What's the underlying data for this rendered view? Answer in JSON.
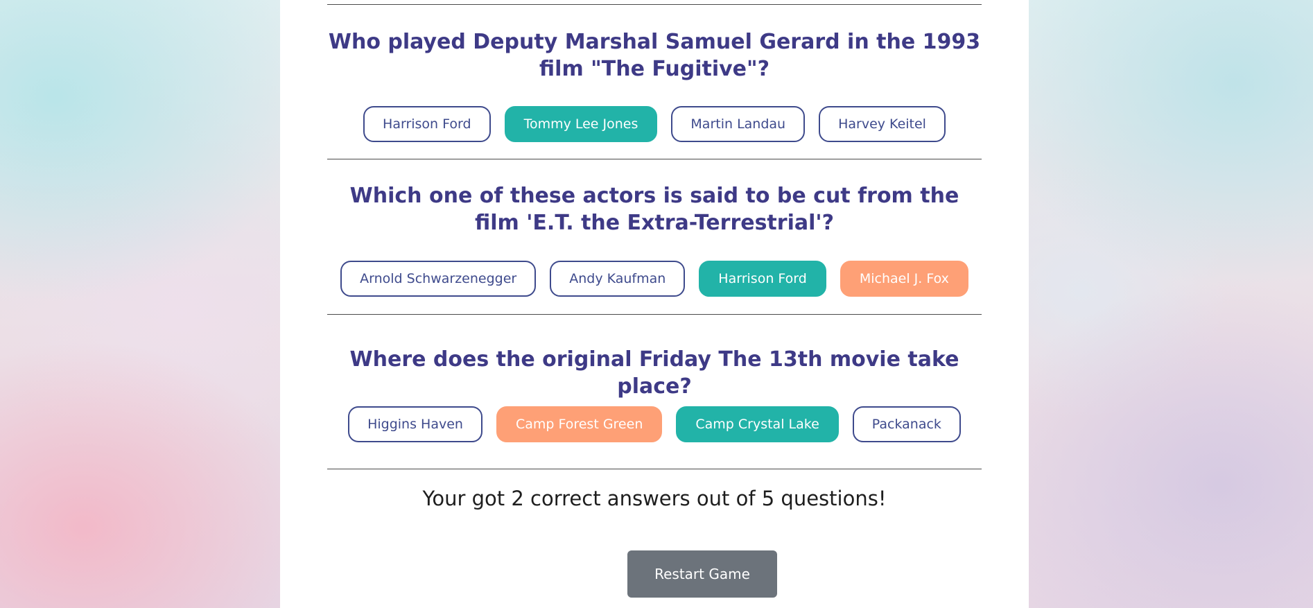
{
  "quiz": {
    "questions": [
      {
        "text": "Who played Deputy Marshal Samuel Gerard in the 1993 film \"The Fugitive\"?",
        "answers": [
          {
            "label": "Harrison Ford",
            "state": "default"
          },
          {
            "label": "Tommy Lee Jones",
            "state": "correct"
          },
          {
            "label": "Martin Landau",
            "state": "default"
          },
          {
            "label": "Harvey Keitel",
            "state": "default"
          }
        ]
      },
      {
        "text": "Which one of these actors is said to be cut from the film 'E.T. the Extra-Terrestrial'?",
        "answers": [
          {
            "label": "Arnold Schwarzenegger",
            "state": "default"
          },
          {
            "label": "Andy Kaufman",
            "state": "default"
          },
          {
            "label": "Harrison Ford",
            "state": "correct"
          },
          {
            "label": "Michael J. Fox",
            "state": "wrong"
          }
        ]
      },
      {
        "text": "Where does the original Friday The 13th movie take place?",
        "answers": [
          {
            "label": "Higgins Haven",
            "state": "default"
          },
          {
            "label": "Camp Forest Green",
            "state": "wrong"
          },
          {
            "label": "Camp Crystal Lake",
            "state": "correct"
          },
          {
            "label": "Packanack",
            "state": "default"
          }
        ]
      }
    ],
    "score_text": "Your got 2 correct answers out of 5 questions!",
    "restart_label": "Restart Game"
  },
  "colors": {
    "question_text": "#3e3a86",
    "answer_border": "#3e4a8c",
    "correct": "#22b3a8",
    "wrong": "#fea076",
    "restart_button": "#6c737b"
  }
}
